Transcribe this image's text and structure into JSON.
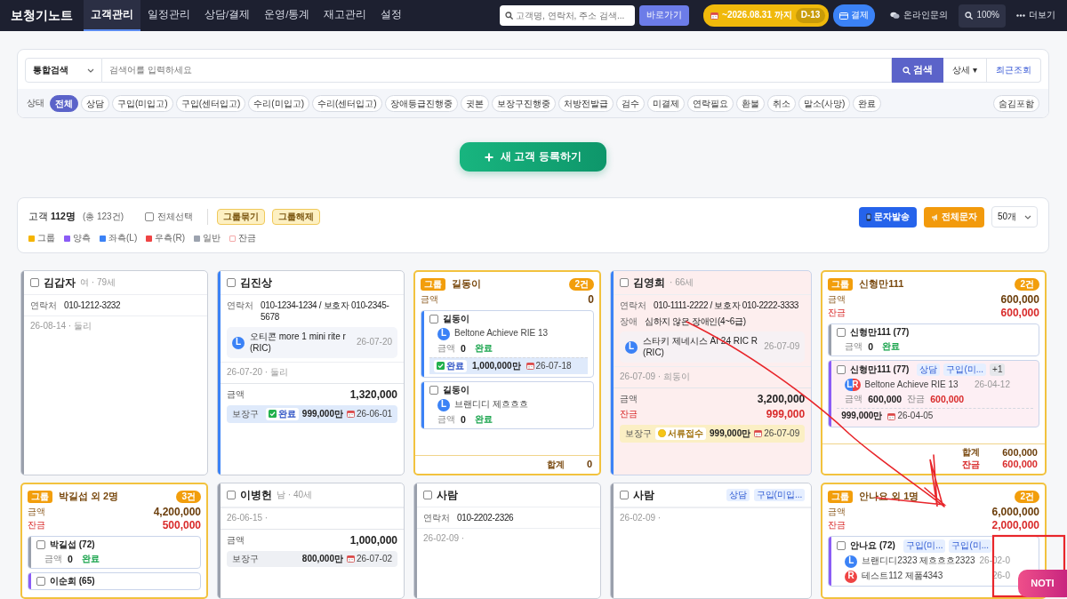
{
  "nav": {
    "brand": "보청기노트",
    "tabs": [
      {
        "label": "고객관리",
        "selected": true
      },
      {
        "label": "일정관리",
        "selected": false
      },
      {
        "label": "상담/결제",
        "selected": false
      },
      {
        "label": "운영/통계",
        "selected": false
      },
      {
        "label": "재고관리",
        "selected": false
      },
      {
        "label": "설정",
        "selected": false
      }
    ],
    "search": {
      "placeholder": "고객명, 연락처, 주소 검색..."
    },
    "go_button": "바로가기",
    "subscription": {
      "label": "~2026.08.31 까지",
      "badge": "D-13"
    },
    "pay_button": "결제",
    "inquiry": "온라인문의",
    "zoom": "100%",
    "more": "더보기"
  },
  "search_panel": {
    "scope": "통합검색",
    "placeholder": "검색어를 입력하세요",
    "search_button": "검색",
    "detail_button": "상세 ▾",
    "recent_button": "최근조회",
    "status_label": "상태",
    "statuses": [
      {
        "label": "전체",
        "selected": true
      },
      {
        "label": "상담",
        "selected": false
      },
      {
        "label": "구입(미입고)",
        "selected": false
      },
      {
        "label": "구입(센터입고)",
        "selected": false
      },
      {
        "label": "수리(미입고)",
        "selected": false
      },
      {
        "label": "수리(센터입고)",
        "selected": false
      },
      {
        "label": "장애등급진행중",
        "selected": false
      },
      {
        "label": "귓본",
        "selected": false
      },
      {
        "label": "보장구진행중",
        "selected": false
      },
      {
        "label": "처방전발급",
        "selected": false
      },
      {
        "label": "검수",
        "selected": false
      },
      {
        "label": "미결제",
        "selected": false
      },
      {
        "label": "연락필요",
        "selected": false
      },
      {
        "label": "환불",
        "selected": false
      },
      {
        "label": "취소",
        "selected": false
      },
      {
        "label": "말소(사망)",
        "selected": false
      },
      {
        "label": "완료",
        "selected": false
      }
    ],
    "hidden_toggle": "숨김포함"
  },
  "new_customer_button": "새 고객 등록하기",
  "summary": {
    "count_text": "고객 **112명**",
    "total": "(총 123건)",
    "select_all": {
      "label": "전체선택",
      "checked": false
    },
    "group_button": "그룹묶기",
    "ungroup_button": "그룹해제",
    "sms_button": "문자발송",
    "bulk_sms_button": "전체문자",
    "page_size": "50개"
  },
  "legend": [
    {
      "label": "그룹",
      "color": "#f5b400",
      "kind": "fill"
    },
    {
      "label": "양측",
      "color": "#8b5cf6",
      "kind": "fill"
    },
    {
      "label": "좌측(L)",
      "color": "#3b82f6",
      "kind": "fill"
    },
    {
      "label": "우측(R)",
      "color": "#ef4444",
      "kind": "fill"
    },
    {
      "label": "일반",
      "color": "#9ca3af",
      "kind": "fill"
    },
    {
      "label": "잔금",
      "color": "#f4a9a9",
      "kind": "outline"
    }
  ],
  "cards": [
    {
      "kind": "person",
      "name": "김갑자",
      "meta": "여 · 79세",
      "checked": false,
      "color": "#9aa0ac",
      "balance_due": false,
      "fields": [
        {
          "label": "연락처",
          "value": "010-1212-3232"
        }
      ],
      "note": "26-08-14 · 둘리"
    },
    {
      "kind": "person",
      "name": "김진상",
      "checked": false,
      "color": "#3b82f6",
      "balance_due": false,
      "fields": [
        {
          "label": "연락처",
          "value": "010-1234-1234 / 보호자 010-2345-5678"
        }
      ],
      "devices": [
        {
          "side": "L",
          "name": "오티콘 more 1 mini rite r (RIC)",
          "date": "26-07-20"
        }
      ],
      "note": "26-07-20 · 둘리",
      "amounts": [
        {
          "label": "금액",
          "value": "1,320,000",
          "kind": "total"
        }
      ],
      "warranty": {
        "label": "보장구",
        "status": "완료",
        "kind": "done",
        "amount": "999,000만",
        "date": "26-06-01"
      }
    },
    {
      "kind": "group",
      "tag": "그룹",
      "name": "길동이",
      "count": "2건",
      "amounts": [
        {
          "label": "금액",
          "value": "0",
          "kind": "total"
        }
      ],
      "members": [
        {
          "name": "길동이",
          "checked": false,
          "color": "#3b82f6",
          "balance_due": false,
          "devices": [
            {
              "side": "L",
              "name": "Beltone Achieve RIE 13"
            }
          ],
          "amounts": [
            {
              "label": "금액",
              "value": "0",
              "kind": "total"
            }
          ],
          "status": "완료",
          "warranty": {
            "status": "완료",
            "kind": "done",
            "amount": "1,000,000만",
            "date": "26-07-18"
          }
        },
        {
          "name": "길동이",
          "checked": false,
          "color": "#3b82f6",
          "balance_due": false,
          "devices": [
            {
              "side": "L",
              "name": "브랜디디 제흐흐흐"
            }
          ],
          "amounts": [
            {
              "label": "금액",
              "value": "0",
              "kind": "total"
            }
          ],
          "status": "완료"
        }
      ],
      "totals": [
        {
          "label": "합계",
          "value": "0",
          "kind": "total"
        }
      ]
    },
    {
      "kind": "person",
      "name": "김영희",
      "meta": "· 66세",
      "checked": false,
      "color": "#3b82f6",
      "balance_due": true,
      "fields": [
        {
          "label": "연락처",
          "value": "010-1111-2222 / 보호자 010-2222-3333"
        },
        {
          "label": "장애",
          "value": "심하지 않은 장애인(4~6급)"
        }
      ],
      "devices": [
        {
          "side": "L",
          "name": "스타키 제네시스 AI 24 RIC R (RIC)",
          "date": "26-07-09"
        }
      ],
      "note": "26-07-09 · 희동이",
      "amounts": [
        {
          "label": "금액",
          "value": "3,200,000",
          "kind": "total"
        },
        {
          "label": "잔금",
          "value": "999,000",
          "kind": "balance"
        }
      ],
      "warranty": {
        "label": "보장구",
        "status": "서류접수",
        "kind": "received",
        "amount": "999,000만",
        "date": "26-07-09"
      }
    },
    {
      "kind": "group",
      "tag": "그룹",
      "name": "신형만111",
      "count": "2건",
      "amounts": [
        {
          "label": "금액",
          "value": "600,000",
          "kind": "total"
        },
        {
          "label": "잔금",
          "value": "600,000",
          "kind": "balance"
        }
      ],
      "members": [
        {
          "name": "신형만111 (77)",
          "checked": false,
          "color": "#9aa0ac",
          "balance_due": false,
          "amounts": [
            {
              "label": "금액",
              "value": "0",
              "kind": "total"
            }
          ],
          "status": "완료"
        },
        {
          "name": "신형만111 (77)",
          "checked": false,
          "color": "#8b5cf6",
          "balance_due": true,
          "tags": [
            "상담",
            "구입(미...",
            "+1"
          ],
          "devices": [
            {
              "side": "LR",
              "name": "Beltone Achieve RIE 13",
              "date": "26-04-12"
            }
          ],
          "amounts": [
            {
              "label": "금액",
              "value": "600,000",
              "kind": "total"
            },
            {
              "label": "잔금",
              "value": "600,000",
              "kind": "balance"
            }
          ],
          "warranty": {
            "kind": "plain",
            "amount": "999,000만",
            "date": "26-04-05"
          }
        }
      ],
      "totals": [
        {
          "label": "합계",
          "value": "600,000",
          "kind": "total"
        },
        {
          "label": "잔금",
          "value": "600,000",
          "kind": "balance"
        }
      ]
    },
    {
      "kind": "group",
      "tag": "그룹",
      "name": "박길섭 외 2명",
      "count": "3건",
      "amounts": [
        {
          "label": "금액",
          "value": "4,200,000",
          "kind": "total"
        },
        {
          "label": "잔금",
          "value": "500,000",
          "kind": "balance"
        }
      ],
      "members": [
        {
          "name": "박길섭 (72)",
          "checked": false,
          "color": "#9aa0ac",
          "balance_due": false,
          "amounts": [
            {
              "label": "금액",
              "value": "0",
              "kind": "total"
            }
          ],
          "status": "완료"
        },
        {
          "name": "이순희 (65)",
          "checked": false,
          "color": "#8b5cf6",
          "balance_due": false
        }
      ]
    },
    {
      "kind": "person",
      "name": "이병헌",
      "meta": "남 · 40세",
      "checked": false,
      "color": "#9aa0ac",
      "balance_due": false,
      "note": "26-06-15 ·",
      "amounts": [
        {
          "label": "금액",
          "value": "1,000,000",
          "kind": "total"
        }
      ],
      "warranty": {
        "label": "보장구",
        "kind": "plain",
        "amount": "800,000만",
        "date": "26-07-02"
      }
    },
    {
      "kind": "person",
      "name": "사람",
      "checked": false,
      "color": "#9aa0ac",
      "balance_due": false,
      "fields": [
        {
          "label": "연락처",
          "value": "010-2202-2326"
        }
      ],
      "note": "26-02-09 ·"
    },
    {
      "kind": "person",
      "name": "사람",
      "checked": false,
      "color": "#9aa0ac",
      "balance_due": false,
      "tags": [
        "상담",
        "구입(미입..."
      ],
      "note": "26-02-09 ·"
    },
    {
      "kind": "group",
      "tag": "그룹",
      "name": "안나요 외 1명",
      "count": "2건",
      "amounts": [
        {
          "label": "금액",
          "value": "6,000,000",
          "kind": "total"
        },
        {
          "label": "잔금",
          "value": "2,000,000",
          "kind": "balance"
        }
      ],
      "members": [
        {
          "name": "안나요 (72)",
          "checked": false,
          "color": "#8b5cf6",
          "balance_due": false,
          "tags": [
            "구입(미...",
            "구입(미..."
          ],
          "devices": [
            {
              "side": "L",
              "name": "브랜디디2323 제흐흐흐2323",
              "date": "26-02-0"
            },
            {
              "side": "R",
              "name": "테스트112 제품4343",
              "date": "26-0"
            }
          ]
        }
      ]
    }
  ],
  "noti_button": "NOTI"
}
